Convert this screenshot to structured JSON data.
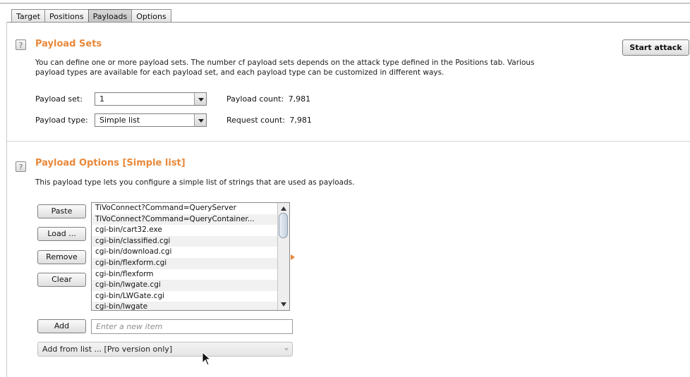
{
  "tabs": [
    "Target",
    "Positions",
    "Payloads",
    "Options"
  ],
  "active_tab": "Payloads",
  "start_attack_label": "Start attack",
  "payload_sets": {
    "title": "Payload Sets",
    "description_line1": "You can define one or more payload sets. The number cf payload sets depends on the attack type defined in the Positions tab. Various",
    "description_line2": "payload types are available for each payload set, and each payload type can be customized in different ways.",
    "payload_set_label": "Payload set:",
    "payload_set_value": "1",
    "payload_type_label": "Payload type:",
    "payload_type_value": "Simple list",
    "payload_count_label": "Payload count:",
    "payload_count_value": "7,981",
    "request_count_label": "Request count:",
    "request_count_value": "7,981"
  },
  "payload_options": {
    "title": "Payload Options [Simple list]",
    "description": "This payload type lets you configure a simple list of strings that are used as payloads.",
    "buttons": {
      "paste": "Paste",
      "load": "Load ...",
      "remove": "Remove",
      "clear": "Clear",
      "add": "Add"
    },
    "list_items": [
      "TiVoConnect?Command=QueryServer",
      "TiVoConnect?Command=QueryContainer...",
      "cgi-bin/cart32.exe",
      "cgi-bin/classified.cgi",
      "cgi-bin/download.cgi",
      "cgi-bin/flexform.cgi",
      "cgi-bin/flexform",
      "cgi-bin/lwgate.cgi",
      "cgi-bin/LWGate.cgi",
      "cgi-bin/lwgate"
    ],
    "new_item_placeholder": "Enter a new item",
    "add_from_list": "Add from list ... [Pro version only]"
  },
  "icons": {
    "help": "?"
  },
  "colors": {
    "heading": "#e8883a",
    "expander": "#e8883a"
  }
}
